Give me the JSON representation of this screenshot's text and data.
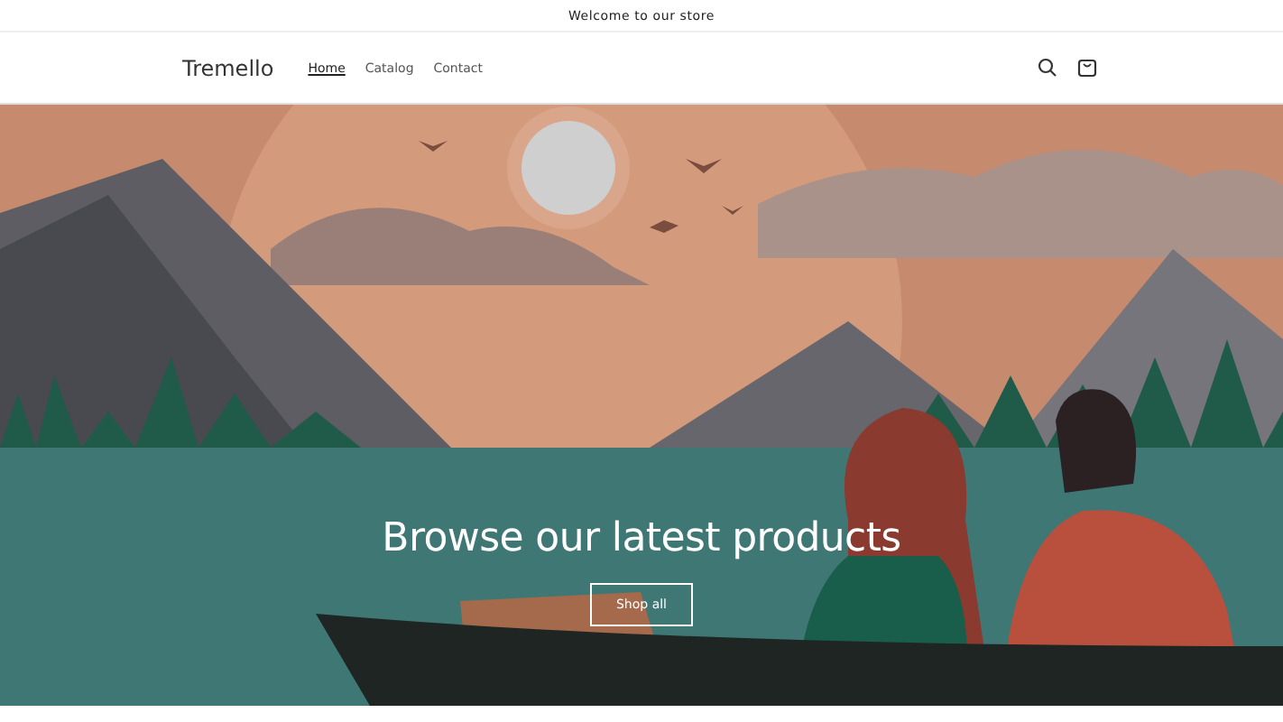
{
  "announcement": {
    "text": "Welcome to our store"
  },
  "header": {
    "logo": "Tremello",
    "nav": [
      {
        "label": "Home",
        "selected": true
      },
      {
        "label": "Catalog",
        "selected": false
      },
      {
        "label": "Contact",
        "selected": false
      }
    ]
  },
  "hero": {
    "heading": "Browse our latest products",
    "button": "Shop all"
  }
}
